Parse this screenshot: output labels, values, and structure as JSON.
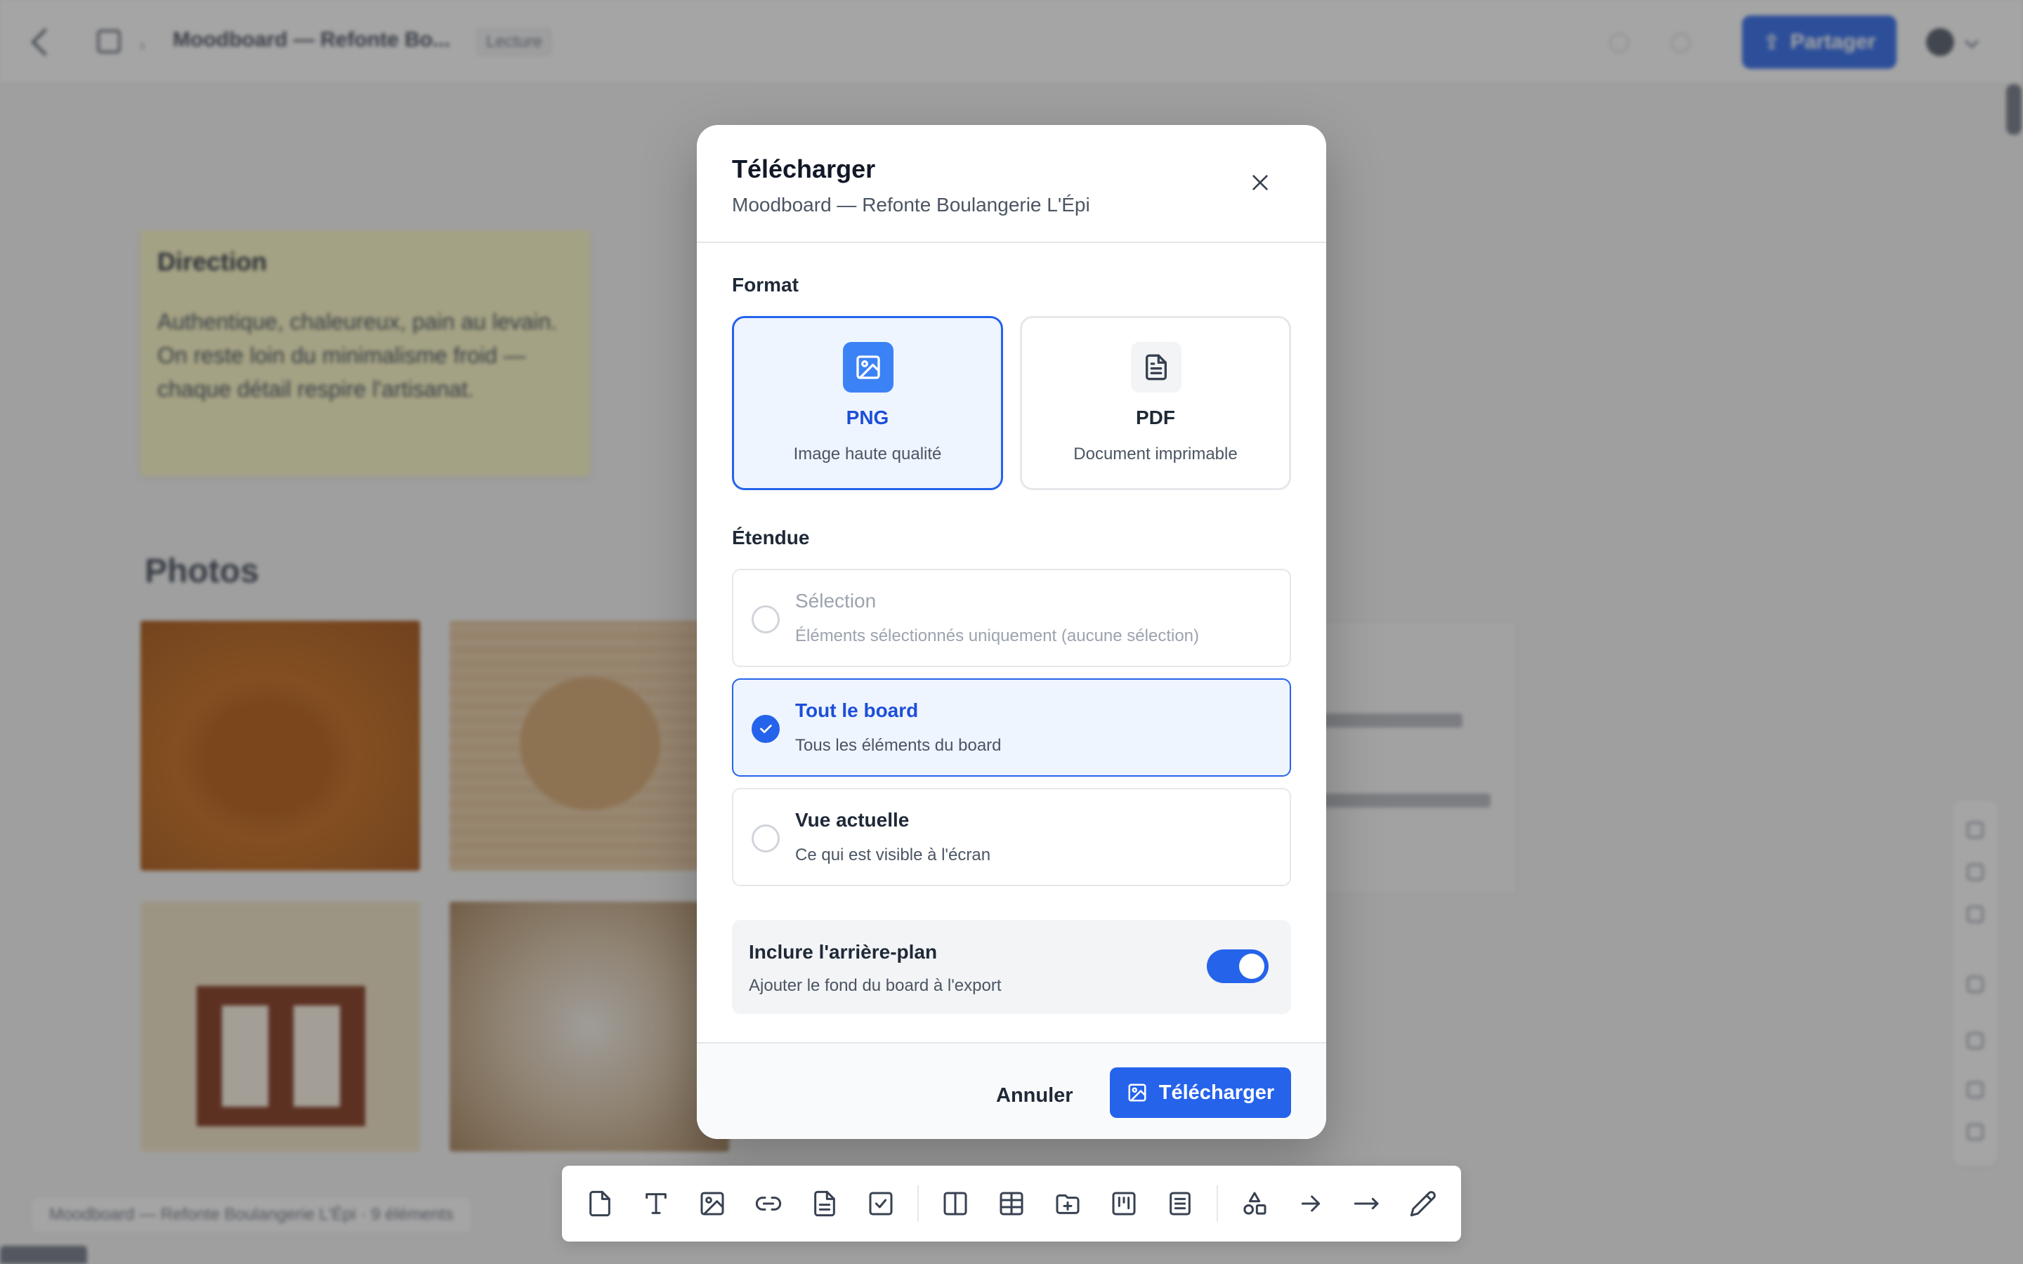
{
  "app": {
    "board_title": "Moodboard — Refonte Bo...",
    "board_badge": "Lecture",
    "share_label": "Partager",
    "footer_info": "Moodboard — Refonte Boulangerie L'Épi · 9 éléments"
  },
  "board": {
    "note": {
      "title": "Direction",
      "body": "Authentique, chaleureux, pain au levain. On reste loin du minimalisme froid — chaque détail respire l'artisanat."
    },
    "section_title": "Photos"
  },
  "modal": {
    "title": "Télécharger",
    "subtitle": "Moodboard — Refonte Boulangerie L'Épi",
    "format_label": "Format",
    "formats": [
      {
        "name": "PNG",
        "desc": "Image haute qualité",
        "selected": true,
        "icon": "image-icon"
      },
      {
        "name": "PDF",
        "desc": "Document imprimable",
        "selected": false,
        "icon": "document-icon"
      }
    ],
    "scope_label": "Étendue",
    "scopes": [
      {
        "title": "Sélection",
        "desc": "Éléments sélectionnés uniquement (aucune sélection)",
        "state": "disabled"
      },
      {
        "title": "Tout le board",
        "desc": "Tous les éléments du board",
        "state": "selected"
      },
      {
        "title": "Vue actuelle",
        "desc": "Ce qui est visible à l'écran",
        "state": "default"
      }
    ],
    "background": {
      "title": "Inclure l'arrière-plan",
      "desc": "Ajouter le fond du board à l'export",
      "enabled": true
    },
    "cancel_label": "Annuler",
    "download_label": "Télécharger"
  },
  "toolbar": {
    "tools": [
      "note-icon",
      "text-icon",
      "image-icon",
      "link-icon",
      "document-icon",
      "todo-icon",
      "column-icon",
      "table-icon",
      "board-icon",
      "kanban-icon",
      "list-icon",
      "shapes-icon",
      "arrow-icon",
      "line-icon",
      "pen-icon"
    ]
  },
  "colors": {
    "accent": "#2563eb",
    "selected_bg": "#eef5ff",
    "overlay": "rgba(55,55,55,0.45)",
    "note_bg": "#fef9c3"
  }
}
